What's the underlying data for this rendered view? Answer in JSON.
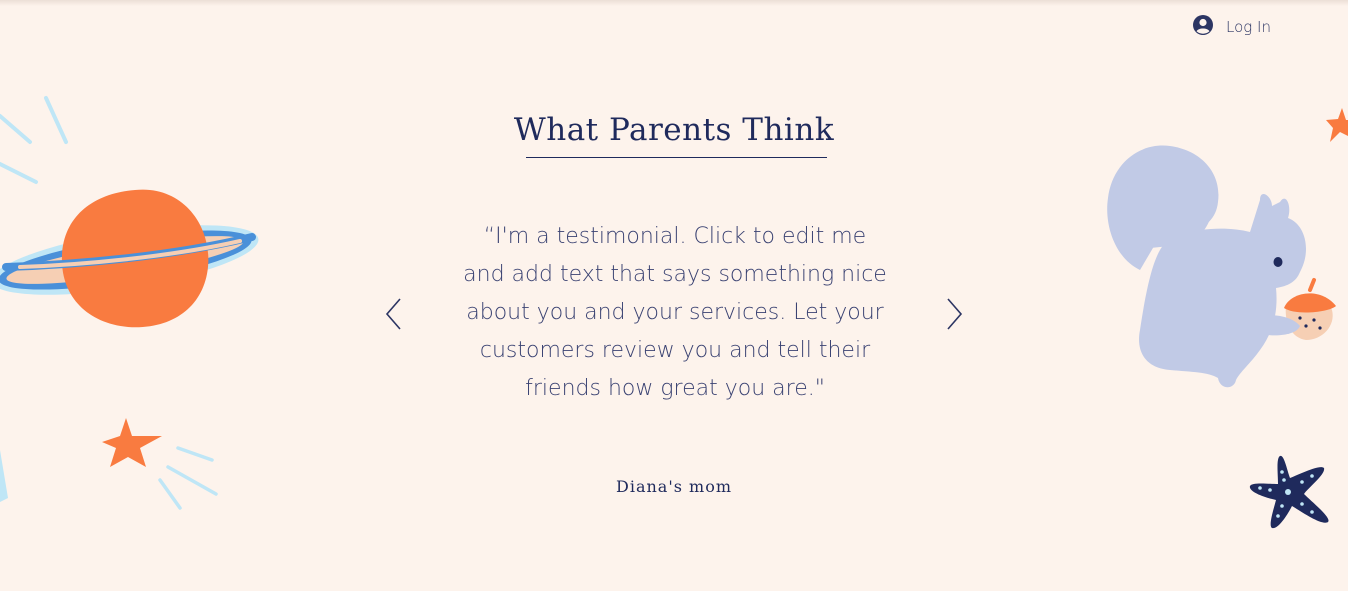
{
  "header": {
    "login_label": "Log In",
    "login_icon": "user-avatar-icon"
  },
  "testimonials": {
    "title": "What Parents Think",
    "quote": "“I'm a testimonial. Click to edit me and add text that says something nice about you and your services. Let your customers review you and tell their friends how great you are.\"",
    "author": "Diana's mom",
    "prev_icon": "chevron-left-icon",
    "next_icon": "chevron-right-icon"
  },
  "colors": {
    "background": "#fdf3ec",
    "navy": "#1f2a5c",
    "orange": "#f97b40",
    "light_blue": "#bfe6f6",
    "lavender": "#c1cae6"
  }
}
